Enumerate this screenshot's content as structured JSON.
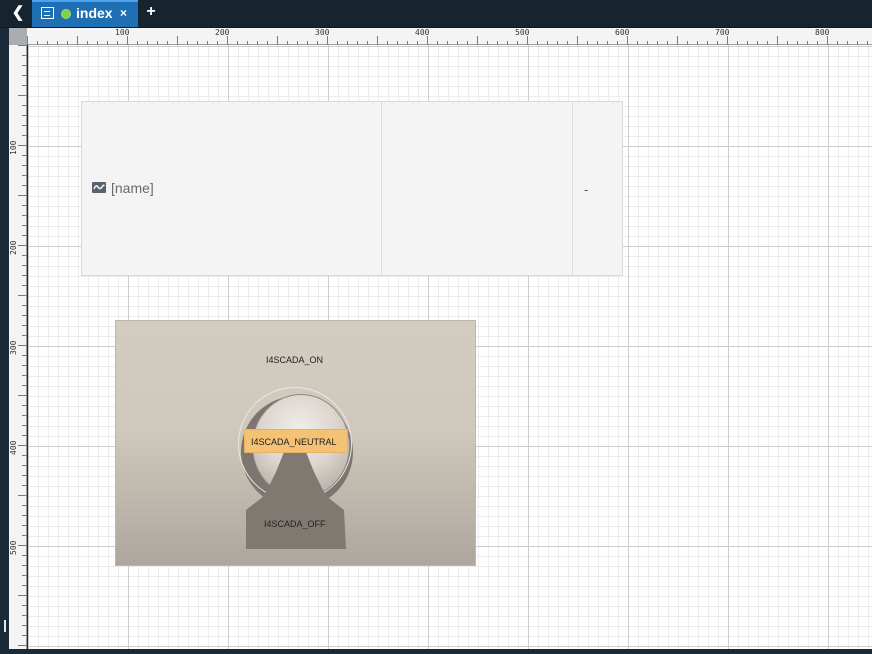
{
  "tab": {
    "back_icon": "chevron-left-icon",
    "icon": "dashboard-icon",
    "status_color": "#7fcf4a",
    "label": "index",
    "close": "×",
    "add": "+"
  },
  "ruler": {
    "h_labels": [
      "100",
      "200",
      "300",
      "400",
      "500",
      "600",
      "700",
      "800"
    ],
    "v_labels": [
      "100",
      "200",
      "300",
      "400",
      "500"
    ]
  },
  "signal_table": {
    "icon": "signal-wave-icon",
    "name": "[name]",
    "value": "-"
  },
  "switch": {
    "on_label": "I4SCADA_ON",
    "neutral_label": "I4SCADA_NEUTRAL",
    "off_label": "I4SCADA_OFF",
    "neutral_color": "#f3c275"
  }
}
